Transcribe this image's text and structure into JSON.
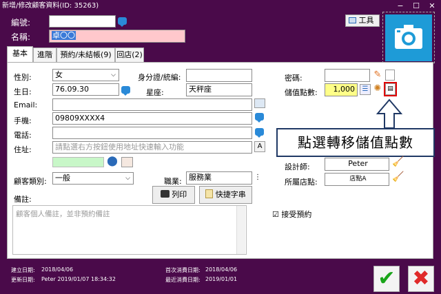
{
  "window": {
    "title": "新增/修改顧客資料(ID: 35263)",
    "minimize": "−",
    "maximize": "☐",
    "close": "✕"
  },
  "header": {
    "id_label": "編號:",
    "id_value": "",
    "name_label": "名稱:",
    "name_value": "卓〇〇",
    "tools_label": "工具"
  },
  "tabs": [
    {
      "label": "基本"
    },
    {
      "label": "進階"
    },
    {
      "label": "預約/未結帳(9)"
    },
    {
      "label": "回店(2)"
    }
  ],
  "form": {
    "gender_label": "性別:",
    "gender_value": "女",
    "id_number_label": "身分證/統編:",
    "id_number_value": "",
    "birthday_label": "生日:",
    "birthday_value": "76.09.30",
    "zodiac_label": "星座:",
    "zodiac_value": "天秤座",
    "email_label": "Email:",
    "email_value": "",
    "mobile_label": "手機:",
    "mobile_value": "09809XXXX4",
    "phone_label": "電話:",
    "phone_value": "",
    "address_label": "住址:",
    "address_placeholder": "請點選右方按鈕使用地址快速輸入功能",
    "category_label": "顧客類別:",
    "category_value": "一般",
    "job_label": "職業:",
    "job_value": "服務業",
    "print_label": "列印",
    "shortcut_label": "快捷字串",
    "notes_label": "備註:",
    "notes_placeholder": "顧客個人備註，並非預約備註",
    "password_label": "密碼:",
    "password_value": "",
    "points_label": "儲值點數:",
    "points_value": "1,000",
    "designer_label": "設計師:",
    "designer_value": "Peter",
    "store_label": "所屬店點:",
    "store_value": "店點A",
    "accept_booking_label": "接受預約",
    "accept_booking_checked": "☑"
  },
  "callout": {
    "text": "點選轉移儲值點數"
  },
  "footer": {
    "created_label": "建立日期:",
    "created_value": "2018/04/06",
    "updated_label": "更新日期:",
    "updated_value": "Peter 2019/01/07 18:34:32",
    "first_visit_label": "首次消費日期:",
    "first_visit_value": "2018/04/06",
    "last_visit_label": "最近消費日期:",
    "last_visit_value": "2019/01/01",
    "ok_icon": "✔",
    "cancel_icon": "✖"
  },
  "colors": {
    "window_bg": "#4a0a4a",
    "name_field_bg": "#ffc8cc",
    "points_field_bg": "#ffff88",
    "callout_border": "#1f3864",
    "highlight_red": "#e00000",
    "camera_tile": "#1e9bd7"
  }
}
